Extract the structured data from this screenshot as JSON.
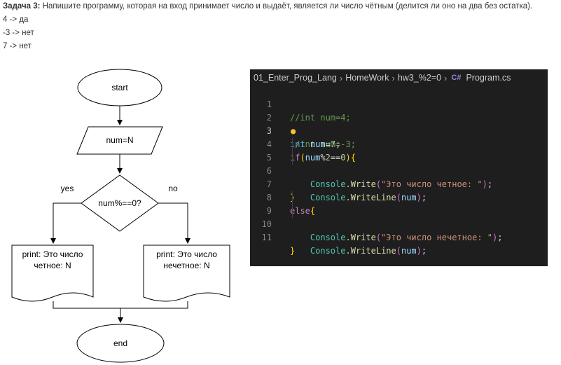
{
  "task": {
    "label": "Задача 3:",
    "text": " Напишите программу, которая на вход принимает число и выдаёт, является ли число чётным (делится ли оно на два без остатка).",
    "examples": [
      "4 -> да",
      "-3 -> нет",
      "7 -> нет"
    ]
  },
  "flowchart": {
    "start": "start",
    "input": "num=N",
    "decision": "num%==0?",
    "yes": "yes",
    "no": "no",
    "print_yes": [
      "print: Это число",
      "четное: N"
    ],
    "print_no": [
      "print: Это число",
      "нечетное: N"
    ],
    "end": "end"
  },
  "editor": {
    "breadcrumbs": [
      "01_Enter_Prog_Lang",
      "HomeWork",
      "hw3_%2=0",
      "Program.cs"
    ],
    "file_icon": "csharp-icon",
    "current_line": 3,
    "line_numbers": [
      "1",
      "2",
      "3",
      "4",
      "5",
      "6",
      "7",
      "8",
      "9",
      "10",
      "11"
    ],
    "lines": [
      "//int num=4;",
      "//int num=-3;",
      "int num=7;",
      "if(num%2==0){",
      "    Console.Write(\"Это число четное: \");",
      "    Console.WriteLine(num);",
      "}",
      "else{",
      "    Console.Write(\"Это число нечетное: \");",
      "    Console.WriteLine(num);",
      "}"
    ]
  },
  "colors": {
    "editor_bg": "#1e1e1e",
    "comment": "#6a9955",
    "keyword": "#569cd6",
    "control": "#c586c0",
    "variable": "#9cdcfe",
    "number": "#b5cea8",
    "class": "#4ec9b0",
    "method": "#dcdcaa",
    "string": "#ce9178"
  }
}
